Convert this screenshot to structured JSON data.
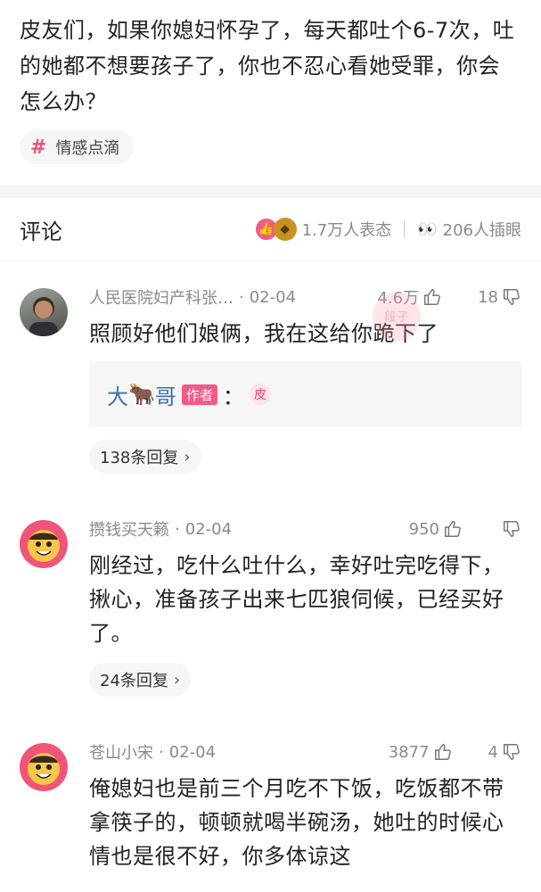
{
  "post": {
    "text": "皮友们，如果你媳妇怀孕了，每天都吐个6-7次，吐的她都不想要孩子了，你也不忍心看她受罪，你会怎么办？",
    "topic": "情感点滴",
    "topic_icon": "hash-icon"
  },
  "comments_header": {
    "title": "评论",
    "reactions": "1.7万人表态",
    "stares": "206人插眼"
  },
  "comments": [
    {
      "author": "人民医院妇产科张…",
      "date": "02-04",
      "likes": "4.6万",
      "dislikes": "18",
      "text": "照顾好他们娘俩，我在这给你跪下了",
      "quote": {
        "name_1": "大",
        "name_2": "哥",
        "badge": "作者",
        "colon": "：",
        "icon_text": "皮"
      },
      "replies": "138条回复"
    },
    {
      "author": "攒钱买天籁",
      "date": "02-04",
      "likes": "950",
      "dislikes": "",
      "text": "刚经过，吃什么吐什么，幸好吐完吃得下，揪心，准备孩子出来七匹狼伺候，已经买好了。",
      "replies": "24条回复"
    },
    {
      "author": "苍山小宋",
      "date": "02-04",
      "likes": "3877",
      "dislikes": "4",
      "text": "俺媳妇也是前三个月吃不下饭，吃饭都不带拿筷子的，顿顿就喝半碗汤，她吐的时候心情也是很不好，你多体谅这"
    }
  ],
  "colors": {
    "accent": "#f35a86",
    "link": "#3b6fb7",
    "meta": "#8a8a8a"
  }
}
